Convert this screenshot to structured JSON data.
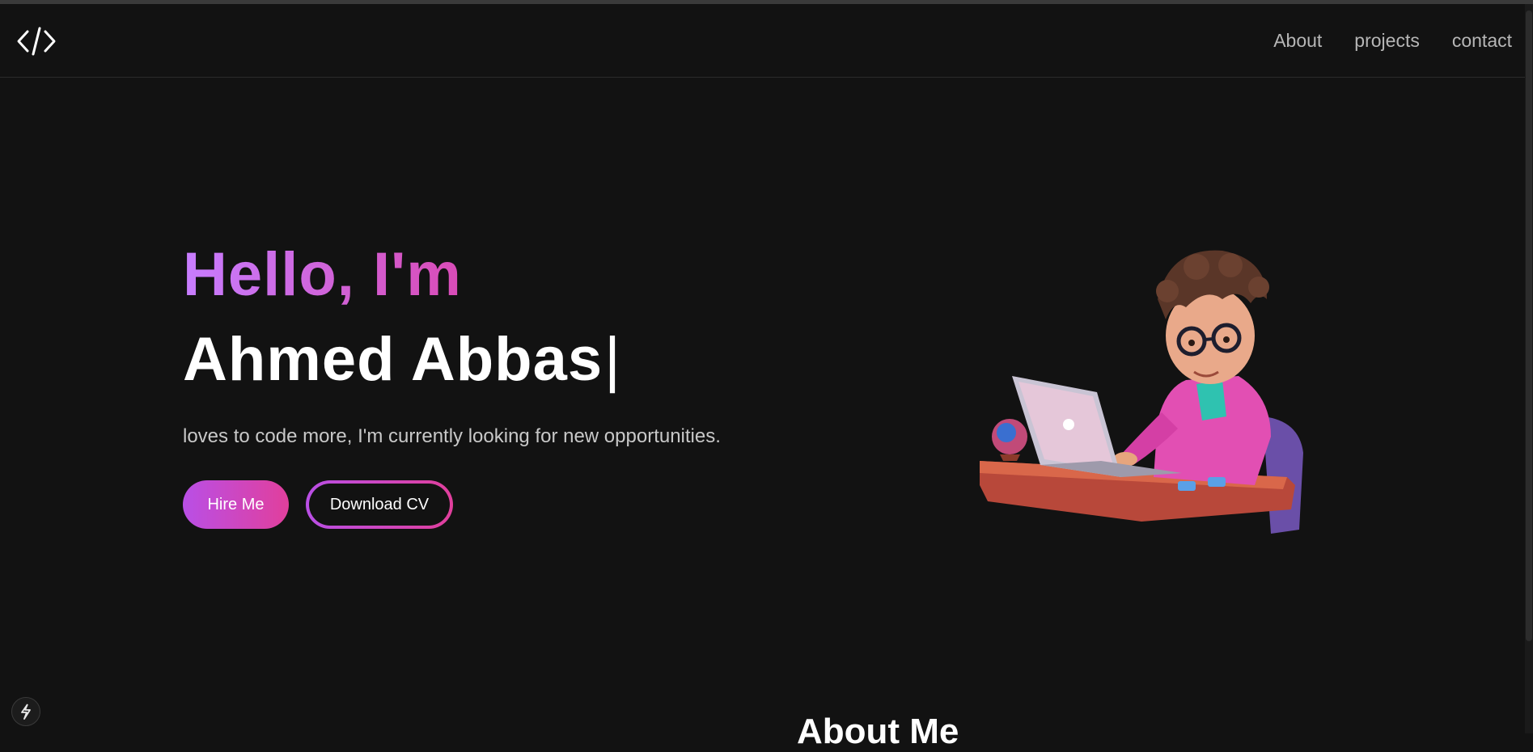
{
  "nav": {
    "logo_icon": "code-brackets-icon",
    "links": [
      "About",
      "projects",
      "contact"
    ]
  },
  "hero": {
    "greeting": "Hello, I'm",
    "name": "Ahmed Abbas",
    "caret": "|",
    "tagline": "loves to code more, I'm currently looking for new opportunities.",
    "hire_label": "Hire Me",
    "cv_label": "Download CV",
    "illustration": "developer-at-laptop-illustration"
  },
  "about": {
    "heading": "About Me"
  },
  "widgets": {
    "bolt_icon": "lightning-bolt-icon"
  },
  "colors": {
    "background": "#121212",
    "gradient_start": "#c77dff",
    "gradient_end": "#e0389a",
    "nav_text": "#b6b6b6"
  }
}
